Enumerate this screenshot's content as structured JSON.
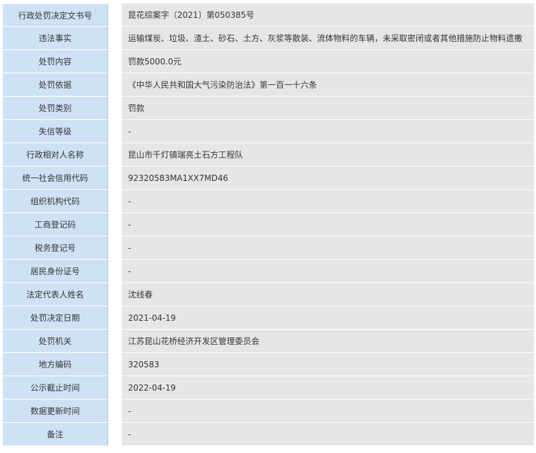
{
  "rows": [
    {
      "key": "decision-number",
      "label": "行政处罚决定文书号",
      "value": "昆花综案字〔2021〕第050385号"
    },
    {
      "key": "violation-facts",
      "label": "违法事实",
      "value": "运输煤炭、垃圾、渣土、砂石、土方、灰浆等散装、流体物料的车辆，未采取密闭或者其他措施防止物料遗撒"
    },
    {
      "key": "penalty-content",
      "label": "处罚内容",
      "value": "罚款5000.0元"
    },
    {
      "key": "penalty-basis",
      "label": "处罚依据",
      "value": "《中华人民共和国大气污染防治法》第一百一十六条"
    },
    {
      "key": "penalty-category",
      "label": "处罚类别",
      "value": "罚款"
    },
    {
      "key": "credit-level",
      "label": "失信等级",
      "value": "-"
    },
    {
      "key": "counterpart-name",
      "label": "行政相对人名称",
      "value": "昆山市千灯镇瑞亮土石方工程队"
    },
    {
      "key": "credit-code",
      "label": "统一社会信用代码",
      "value": "92320583MA1XX7MD46"
    },
    {
      "key": "org-code",
      "label": "组织机构代码",
      "value": "-"
    },
    {
      "key": "business-reg",
      "label": "工商登记码",
      "value": "-"
    },
    {
      "key": "tax-reg",
      "label": "税务登记号",
      "value": "-"
    },
    {
      "key": "id-number",
      "label": "居民身份证号",
      "value": "-"
    },
    {
      "key": "legal-rep",
      "label": "法定代表人姓名",
      "value": "沈线春"
    },
    {
      "key": "decision-date",
      "label": "处罚决定日期",
      "value": "2021-04-19"
    },
    {
      "key": "penalty-authority",
      "label": "处罚机关",
      "value": "江苏昆山花桥经济开发区管理委员会"
    },
    {
      "key": "region-code",
      "label": "地方编码",
      "value": "320583"
    },
    {
      "key": "publicity-deadline",
      "label": "公示截止时间",
      "value": "2022-04-19"
    },
    {
      "key": "data-update-time",
      "label": "数据更新时间",
      "value": "-"
    },
    {
      "key": "remarks",
      "label": "备注",
      "value": "-"
    }
  ]
}
